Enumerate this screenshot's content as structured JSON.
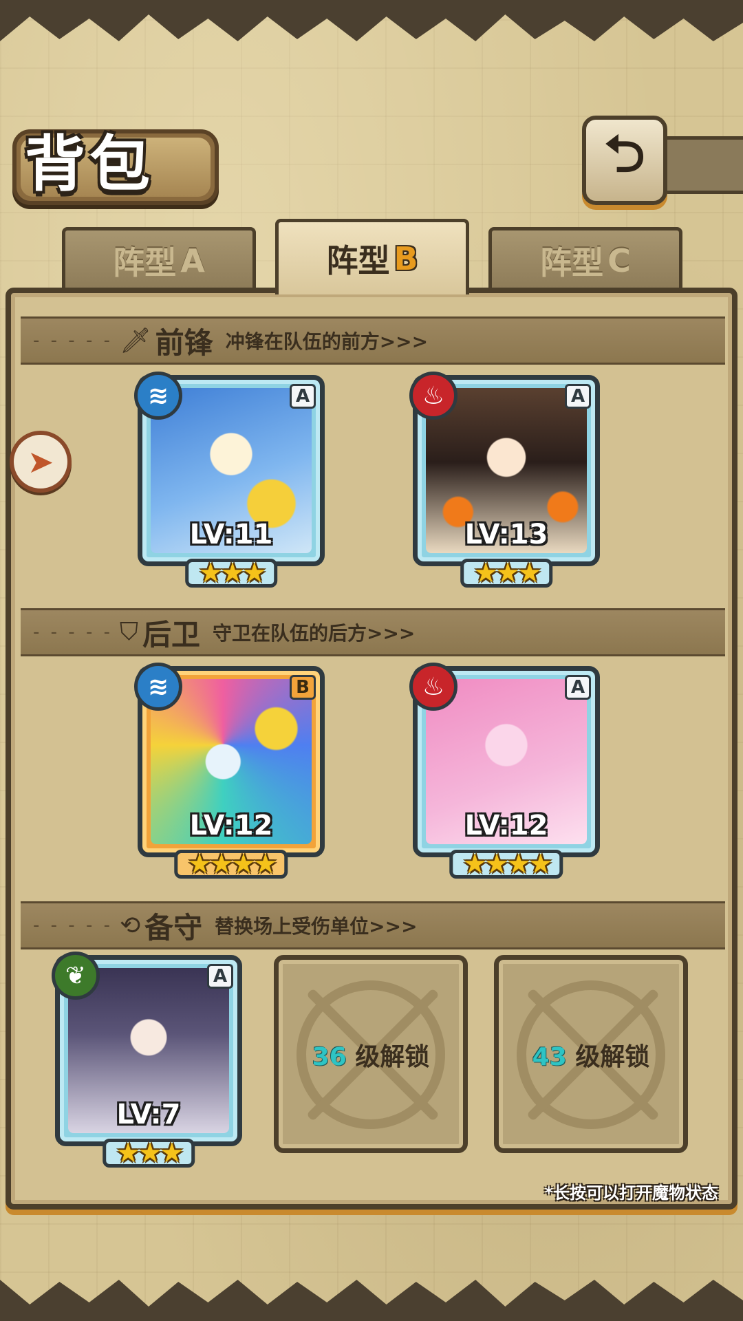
{
  "header": {
    "title": "背包",
    "back_icon": "back-arrow-icon"
  },
  "tabs": [
    {
      "label": "阵型",
      "letter": "A",
      "active": false
    },
    {
      "label": "阵型",
      "letter": "B",
      "active": true
    },
    {
      "label": "阵型",
      "letter": "C",
      "active": false
    }
  ],
  "sections": {
    "front": {
      "name": "前锋",
      "desc": "冲锋在队伍的前方>>>",
      "icon": "sword-icon"
    },
    "rear": {
      "name": "后卫",
      "desc": "守卫在队伍的后方>>>",
      "icon": "shield-icon"
    },
    "reserve": {
      "name": "备守",
      "desc": "替换场上受伤单位>>>",
      "icon": "swap-icon"
    }
  },
  "cards": [
    {
      "id": "front1",
      "level": "LV:11",
      "grade": "A",
      "element": "water",
      "stars": "★★★"
    },
    {
      "id": "front2",
      "level": "LV:13",
      "grade": "A",
      "element": "fire",
      "stars": "★★★"
    },
    {
      "id": "rear1",
      "level": "LV:12",
      "grade": "B",
      "element": "water",
      "stars": "★★★★"
    },
    {
      "id": "rear2",
      "level": "LV:12",
      "grade": "A",
      "element": "fire",
      "stars": "★★★★"
    },
    {
      "id": "reserve1",
      "level": "LV:7",
      "grade": "A",
      "element": "wood",
      "stars": "★★★"
    }
  ],
  "locked_slots": [
    {
      "level": "36",
      "label": "级解锁"
    },
    {
      "level": "43",
      "label": "级解锁"
    }
  ],
  "hint": "*长按可以打开魔物状态",
  "colors": {
    "accent": "#e89b1e",
    "water": "#2b7fc7",
    "fire": "#c8252a",
    "wood": "#3d7a2a"
  }
}
